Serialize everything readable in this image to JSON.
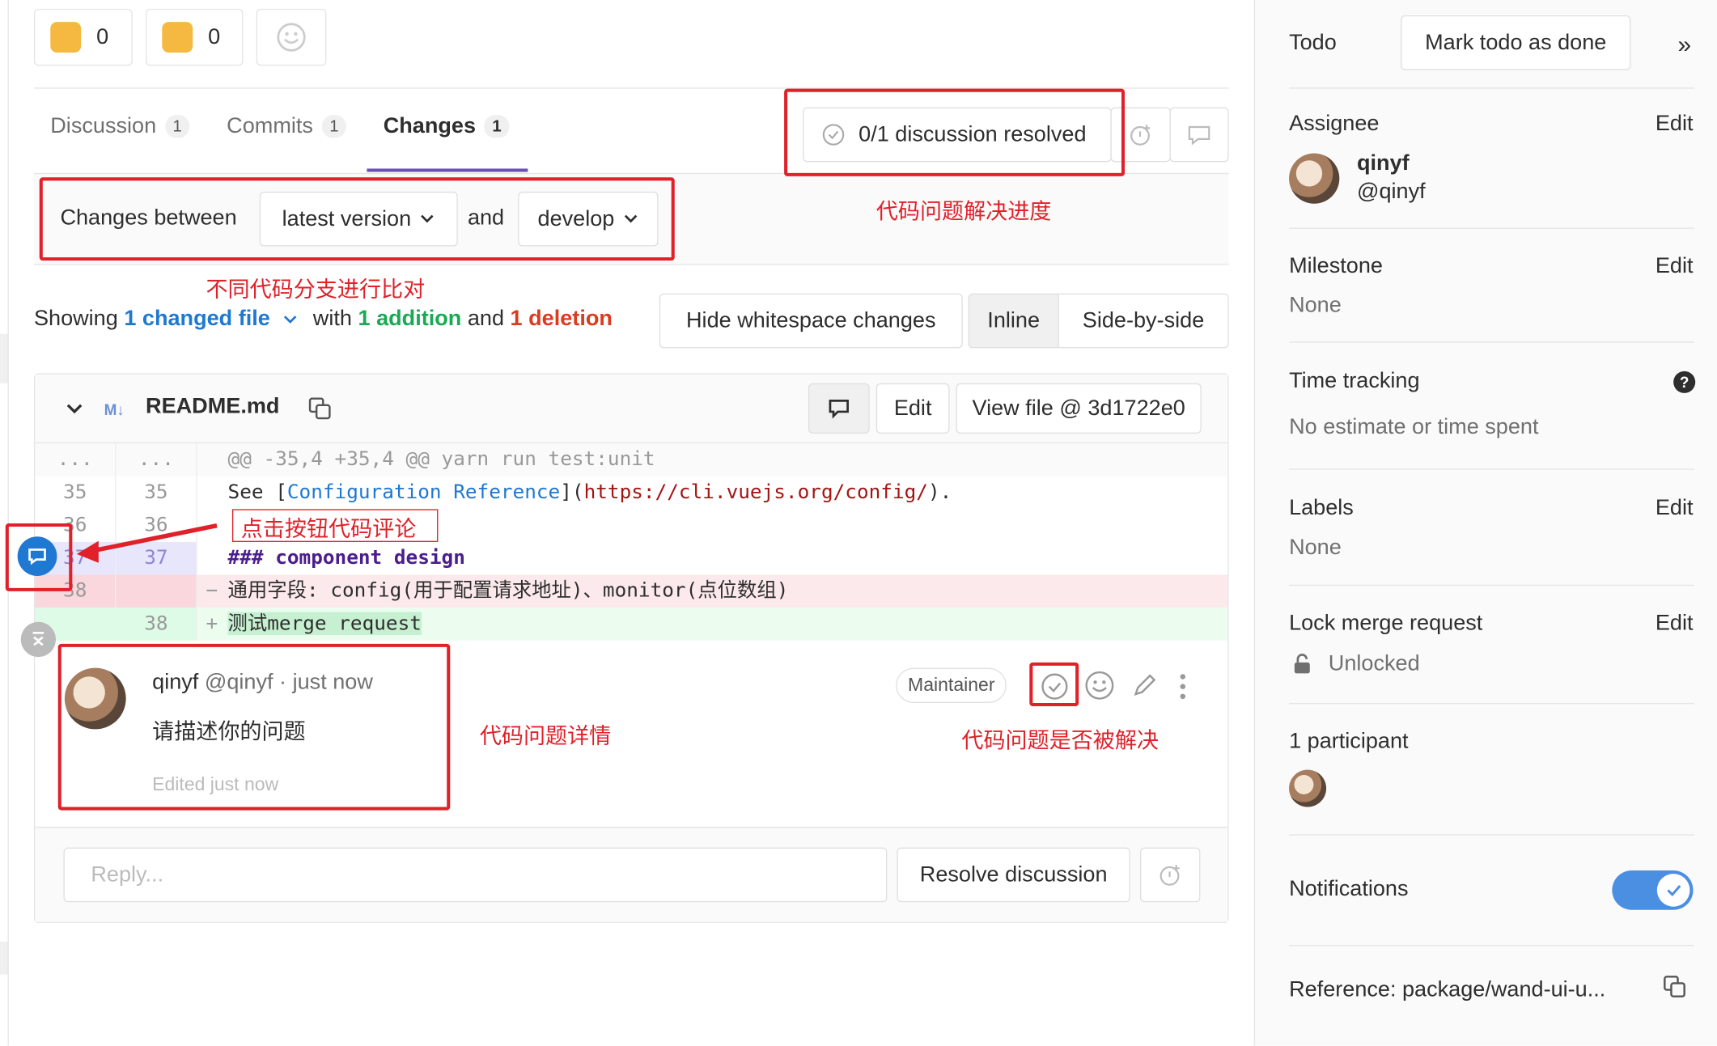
{
  "awards": {
    "thumbs_up_count": "0",
    "thumbs_down_count": "0"
  },
  "tabs": [
    {
      "label": "Discussion",
      "count": "1"
    },
    {
      "label": "Commits",
      "count": "1"
    },
    {
      "label": "Changes",
      "count": "1"
    }
  ],
  "discussion_status": {
    "label": "0/1 discussion resolved"
  },
  "compare": {
    "prefix": "Changes between",
    "from": "latest version",
    "and": "and",
    "to": "develop"
  },
  "summary": {
    "showing": "Showing",
    "changed": "1 changed file",
    "with": "with",
    "additions": "1 addition",
    "and": "and",
    "deletions": "1 deletion"
  },
  "view_controls": {
    "whitespace": "Hide whitespace changes",
    "inline": "Inline",
    "side": "Side-by-side"
  },
  "file": {
    "name": "README.md",
    "type_badge": "M↓",
    "edit": "Edit",
    "view": "View file @ 3d1722e0"
  },
  "diff": {
    "hunk": "@@ -35,4 +35,4 @@ yarn run test:unit",
    "hunk_ln": "...",
    "rows": [
      {
        "old": "35",
        "new": "35",
        "text": "See [Configuration Reference](https://cli.vuejs.org/config/)."
      },
      {
        "old": "36",
        "new": "36",
        "text": ""
      },
      {
        "old": "37",
        "new": "37",
        "text": "### component design"
      },
      {
        "old": "38",
        "new": "",
        "text": "通用字段: config(用于配置请求地址)、monitor(点位数组)"
      },
      {
        "old": "",
        "new": "38",
        "text": "测试merge request"
      }
    ],
    "code_link_text": "Configuration Reference",
    "code_url": "https://cli.vuejs.org/config/"
  },
  "comment": {
    "author": "qinyf",
    "handle": "@qinyf",
    "time": "· just now",
    "body": "请描述你的问题",
    "edited": "Edited just now",
    "role": "Maintainer"
  },
  "reply": {
    "placeholder": "Reply...",
    "resolve": "Resolve discussion"
  },
  "annotations": {
    "progress": "代码问题解决进度",
    "compare": "不同代码分支进行比对",
    "click": "点击按钮代码评论",
    "detail": "代码问题详情",
    "resolved": "代码问题是否被解决"
  },
  "sidebar": {
    "todo": "Todo",
    "mark_done": "Mark todo as done",
    "assignee": "Assignee",
    "edit": "Edit",
    "assignee_name": "qinyf",
    "assignee_handle": "@qinyf",
    "milestone": "Milestone",
    "milestone_val": "None",
    "time_tracking": "Time tracking",
    "time_val": "No estimate or time spent",
    "labels": "Labels",
    "labels_val": "None",
    "lock": "Lock merge request",
    "lock_val": "Unlocked",
    "participants": "1 participant",
    "notifications": "Notifications",
    "reference": "Reference: package/wand-ui-u..."
  },
  "colors": {
    "accent": "#6b4fbb",
    "link": "#1f78d1",
    "added": "#1aaa55",
    "deleted": "#db3b21",
    "annotation": "#e0212a"
  }
}
